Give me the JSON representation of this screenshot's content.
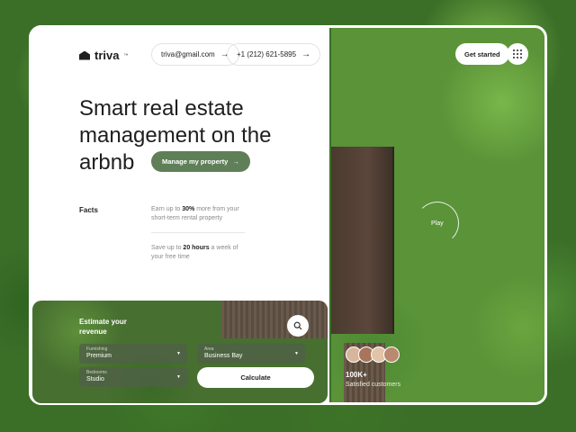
{
  "brand": {
    "name": "triva",
    "trademark": "™"
  },
  "contact": {
    "email": "triva@gmail.com",
    "phone": "+1 (212) 621-5895",
    "arrow": "→"
  },
  "hero": {
    "headline": "Smart real estate management on the arbnb",
    "cta_label": "Manage my property",
    "cta_arrow": "→"
  },
  "facts": {
    "label": "Facts",
    "items": [
      {
        "prefix": "Earn up to ",
        "highlight": "30%",
        "suffix": " more from your short-term rental property"
      },
      {
        "prefix": "Save up to ",
        "highlight": "20 hours",
        "suffix": " a week of your free time"
      }
    ]
  },
  "estimate": {
    "title": "Estimate your revenue",
    "fields": [
      {
        "label": "Furnishing",
        "value": "Premium"
      },
      {
        "label": "Area",
        "value": "Business Bay"
      },
      {
        "label": "Bedrooms",
        "value": "Studio"
      }
    ],
    "calculate_label": "Calculate"
  },
  "header_right": {
    "get_started_label": "Get started"
  },
  "video": {
    "play_label": "Play"
  },
  "stats": {
    "value": "100K+",
    "label": "Satisfied customers"
  },
  "colors": {
    "accent": "#5f7f58",
    "text": "#1e1e1e",
    "muted": "#8a8a8a"
  },
  "icons": {
    "logo": "house-roof-icon",
    "search": "search-icon",
    "menu": "grid-dots-icon",
    "dropdown": "chevron-down-icon"
  }
}
